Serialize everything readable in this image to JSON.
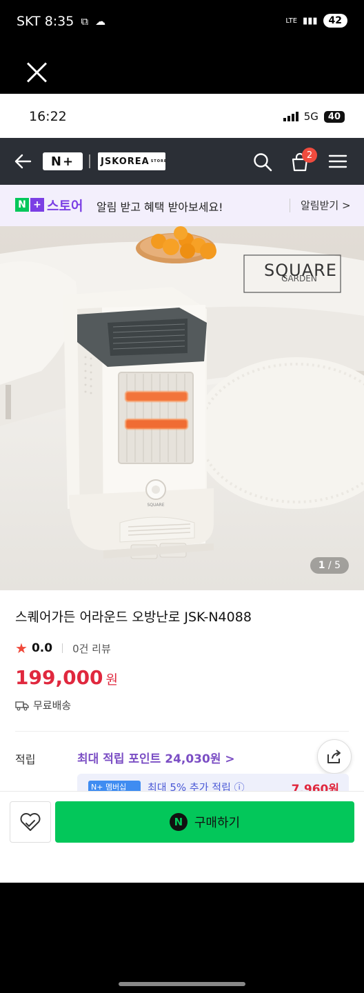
{
  "outer_status": {
    "carrier_time": "SKT 8:35",
    "network": "LTE",
    "battery": "42"
  },
  "inner_status": {
    "time": "16:22",
    "network": "5G",
    "battery": "40"
  },
  "nav": {
    "logo_n": "N+",
    "logo_brand": "JSKOREA",
    "logo_brand_small": "STORE",
    "cart_count": "2"
  },
  "promo": {
    "n_badge": "N",
    "plus_badge": "+",
    "store_label": "스토어",
    "message": "알림 받고 혜택 받아보세요!",
    "cta": "알림받기 >"
  },
  "hero": {
    "brand_line1": "SQUARE",
    "brand_line2": "GARDEN",
    "dial_label": "SQUARE",
    "counter_current": "1",
    "counter_total": "/ 5"
  },
  "product": {
    "title": "스퀘어가든 어라운드 오방난로 JSK-N4088",
    "rating": "0.0",
    "reviews": "0건 리뷰",
    "price": "199,000",
    "price_unit": "원",
    "shipping": "무료배송",
    "points_label": "적립",
    "points_value": "최대 적립 포인트 24,030원 >",
    "member_tag": "N+ 멤버십",
    "member_text": "최대 5% 추가 적립 ⓘ",
    "member_amount": "7,960원"
  },
  "bottom": {
    "buy_label": "구매하기",
    "naver_n": "N"
  },
  "colors": {
    "accent_purple": "#7b3fe4",
    "price_red": "#e0283e",
    "buy_green": "#03c75a",
    "nav_dark": "#2b2f36"
  }
}
